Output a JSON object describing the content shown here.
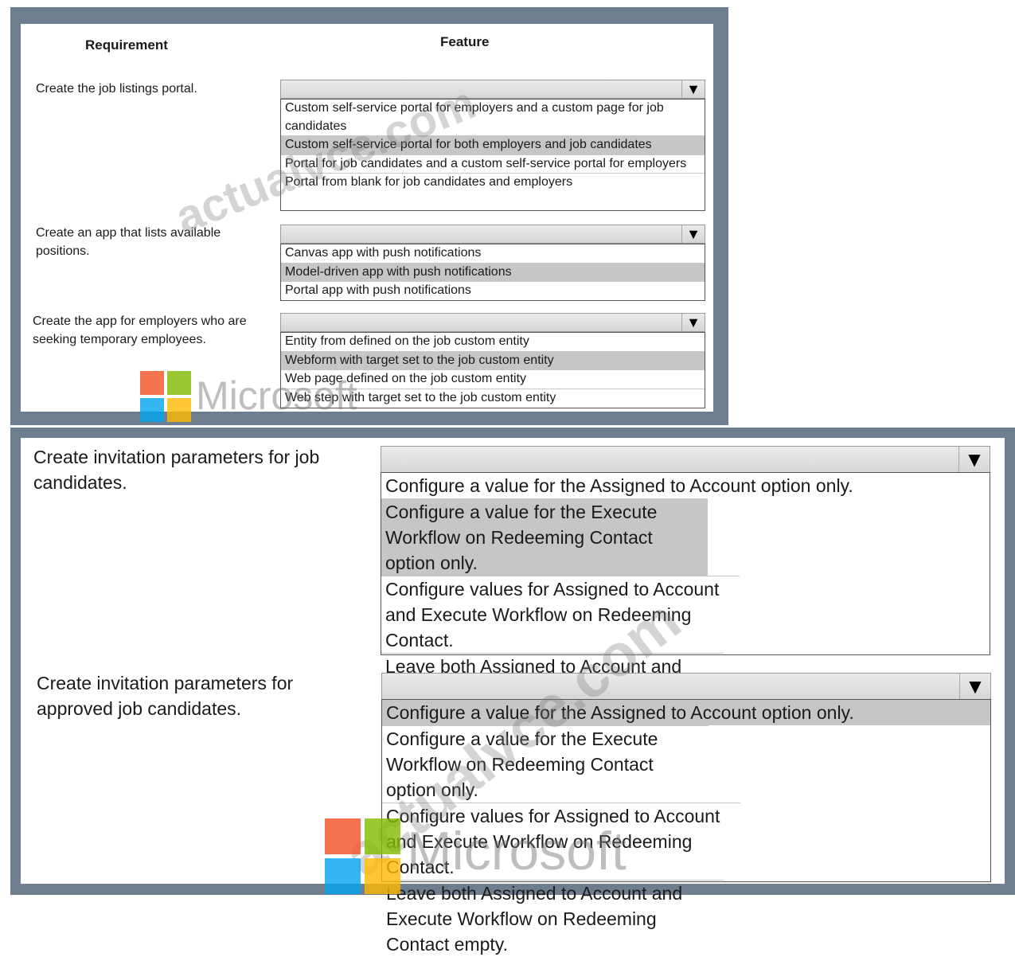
{
  "headers": {
    "requirement": "Requirement",
    "feature": "Feature"
  },
  "section_top": [
    {
      "requirement": "Create the job listings portal.",
      "options": [
        "Custom self-service portal for employers and a custom page for job candidates",
        "Custom self-service portal for both employers and job candidates",
        "Portal for job candidates and a custom self-service portal for employers",
        "Portal from blank for job candidates and employers"
      ],
      "selected_index": 1
    },
    {
      "requirement": "Create an app that lists available positions.",
      "options": [
        "Canvas app with push notifications",
        "Model-driven app with push notifications",
        "Portal app with push notifications"
      ],
      "selected_index": 1
    },
    {
      "requirement": "Create the app for employers who are seeking temporary employees.",
      "options": [
        "Entity from defined on the job custom entity",
        "Webform with target set to the job custom entity",
        "Web page defined on the job custom entity",
        "Web step with target set to the job custom entity"
      ],
      "selected_index": 1
    }
  ],
  "section_bottom": [
    {
      "requirement": "Create invitation parameters for job candidates.",
      "options": [
        "Configure a value for the Assigned to Account option only.",
        "Configure a value for the Execute Workflow on Redeeming Contact option only.",
        "Configure values for Assigned to Account and Execute Workflow on Redeeming Contact.",
        "Leave both Assigned to Account and Execute Workflow on Redeeming Contact empty."
      ],
      "selected_index": 1
    },
    {
      "requirement": "Create invitation parameters for approved job candidates.",
      "options": [
        "Configure a value for the Assigned to Account option only.",
        "Configure a value for the Execute Workflow on Redeeming Contact option only.",
        "Configure values for Assigned to Account and Execute Workflow on Redeeming Contact.",
        "Leave both Assigned to Account and Execute Workflow on Redeeming Contact empty."
      ],
      "selected_index": 0
    }
  ],
  "watermarks": {
    "site": "actualvce.com",
    "brand": "Microsoft"
  },
  "icons": {
    "dropdown": "dropdown-arrow-icon",
    "logo": "microsoft-logo-icon"
  },
  "colors": {
    "frame": "#6f7e8e",
    "selected_row": "#c6c6c6",
    "logo_red": "#f25022",
    "logo_green": "#7fba00",
    "logo_blue": "#00a4ef",
    "logo_yellow": "#ffb900"
  }
}
